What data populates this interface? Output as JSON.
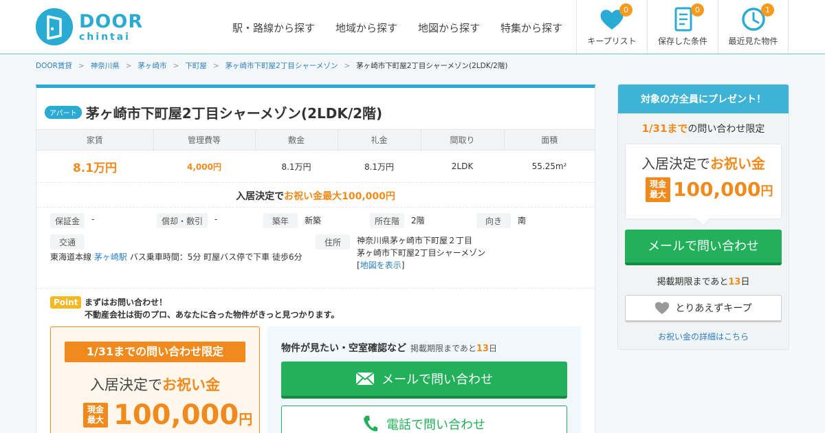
{
  "header": {
    "logo_top": "DOOR",
    "logo_bottom": "chintai",
    "nav": [
      "駅・路線から探す",
      "地域から探す",
      "地図から探す",
      "特集から探す"
    ],
    "buttons": [
      {
        "label": "キープリスト",
        "count": "0",
        "icon": "heart-icon"
      },
      {
        "label": "保存した条件",
        "count": "0",
        "icon": "document-icon"
      },
      {
        "label": "最近見た物件",
        "count": "1",
        "icon": "clock-icon"
      }
    ],
    "accent_color": "#29abd4"
  },
  "breadcrumb": [
    "DOOR賃貸",
    "神奈川県",
    "茅ヶ崎市",
    "下町屋",
    "茅ヶ崎市下町屋2丁目シャーメゾン",
    "茅ヶ崎市下町屋2丁目シャーメゾン(2LDK/2階)"
  ],
  "property": {
    "type_tag": "アパート",
    "title": "茅ヶ崎市下町屋2丁目シャーメゾン(2LDK/2階)",
    "headers": [
      "家賃",
      "管理費等",
      "敷金",
      "礼金",
      "間取り",
      "面積"
    ],
    "rent": "8.1万円",
    "management": "4,000円",
    "deposit": "8.1万円",
    "key_money": "8.1万円",
    "layout": "2LDK",
    "area": "55.25m²",
    "bonus_prefix": "入居決定で",
    "bonus_text": "お祝い金最大100,000円",
    "attributes": [
      {
        "label": "保証金",
        "value": "-"
      },
      {
        "label": "償却・敷引",
        "value": "-"
      },
      {
        "label": "築年",
        "value": "新築"
      },
      {
        "label": "所在階",
        "value": "2階"
      },
      {
        "label": "向き",
        "value": "南"
      }
    ],
    "traffic_label": "交通",
    "traffic_line": "東海道本線",
    "traffic_station": "茅ヶ崎駅",
    "traffic_detail": "バス乗車時間：5分 町屋バス停で下車 徒歩6分",
    "address_label": "住所",
    "address_line1": "神奈川県茅ヶ崎市下町屋２丁目",
    "address_line2": "茅ヶ崎市下町屋2丁目シャーメゾン",
    "map_link": "地図を表示"
  },
  "point": {
    "tag": "Point",
    "line1": "まずはお問い合わせ！",
    "line2": "不動産会社は街のプロ、あなたに合った物件がきっと見つかります。"
  },
  "gift": {
    "header": "1/31までの問い合わせ限定",
    "line_prefix": "入居決定で",
    "line_emph": "お祝い金",
    "cash_tag_top": "現金",
    "cash_tag_bottom": "最大",
    "amount": "100,000",
    "unit": "円"
  },
  "contact": {
    "heading": "物件が見たい・空室確認など",
    "deadline_prefix": "掲載期限まであと",
    "deadline_days": "13",
    "deadline_suffix": "日",
    "mail_button": "メールで問い合わせ",
    "tel_button": "電話で問い合わせ"
  },
  "sidebar": {
    "header": "対象の方全員にプレゼント！",
    "limit_date": "1/31まで",
    "limit_text": "の問い合わせ限定",
    "line_prefix": "入居決定で",
    "line_emph": "お祝い金",
    "cash_tag_top": "現金",
    "cash_tag_bottom": "最大",
    "amount": "100,000",
    "unit": "円",
    "mail_button": "メールで問い合わせ",
    "deadline_prefix": "掲載期限まであと",
    "deadline_days": "13",
    "deadline_suffix": "日",
    "keep_button": "とりあえずキープ",
    "detail_link": "お祝い金の詳細はこちら"
  }
}
